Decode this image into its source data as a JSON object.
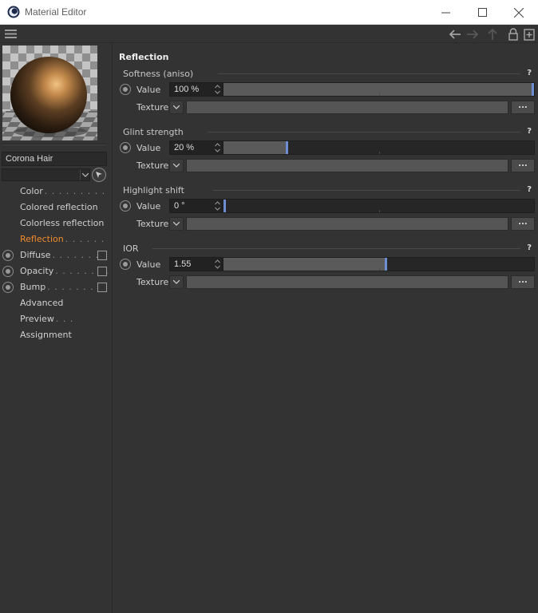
{
  "window": {
    "title": "Material Editor"
  },
  "material": {
    "name": "Corona Hair",
    "selector_value": ""
  },
  "nav": {
    "items": [
      {
        "label": "Color",
        "dots": ". . . . . . . . .",
        "radio": false,
        "check": false,
        "active": false
      },
      {
        "label": "Colored reflection",
        "dots": "",
        "radio": false,
        "check": false,
        "active": false
      },
      {
        "label": "Colorless reflection",
        "dots": "",
        "radio": false,
        "check": false,
        "active": false
      },
      {
        "label": "Reflection",
        "dots": ". . . . . .",
        "radio": false,
        "check": false,
        "active": true
      },
      {
        "label": "Diffuse",
        "dots": ". . . . . . . . .",
        "radio": true,
        "check": true,
        "active": false
      },
      {
        "label": "Opacity",
        "dots": ". . . . . . . .",
        "radio": true,
        "check": true,
        "active": false
      },
      {
        "label": "Bump",
        "dots": ". . . . . . . . . .",
        "radio": true,
        "check": true,
        "active": false
      },
      {
        "label": "Advanced",
        "dots": "",
        "radio": false,
        "check": false,
        "active": false
      },
      {
        "label": "Preview",
        "dots": ". . .",
        "radio": false,
        "check": false,
        "active": false
      },
      {
        "label": "Assignment",
        "dots": "",
        "radio": false,
        "check": false,
        "active": false
      }
    ]
  },
  "main": {
    "section_title": "Reflection",
    "groups": [
      {
        "title": "Softness (aniso)",
        "help": "?",
        "value_label": "Value",
        "value": "100 %",
        "fraction": 1.0,
        "texture_label": "Texture",
        "browse": "..."
      },
      {
        "title": "Glint strength",
        "help": "?",
        "value_label": "Value",
        "value": "20 %",
        "fraction": 0.2,
        "texture_label": "Texture",
        "browse": "..."
      },
      {
        "title": "Highlight shift",
        "help": "?",
        "value_label": "Value",
        "value": "0 °",
        "fraction": 0.0,
        "texture_label": "Texture",
        "browse": "..."
      },
      {
        "title": "IOR",
        "help": "?",
        "value_label": "Value",
        "value": "1.55",
        "fraction": 0.52,
        "texture_label": "Texture",
        "browse": "..."
      }
    ]
  },
  "colors": {
    "accent": "#f08a2b",
    "slider_handle": "#6d8fd1"
  }
}
